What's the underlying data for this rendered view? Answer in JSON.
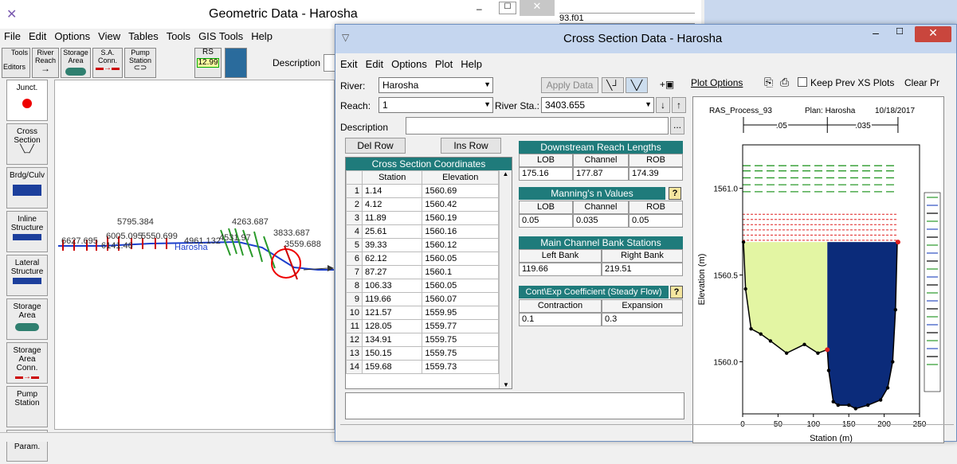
{
  "geo_window": {
    "title": "Geometric Data - Harosha",
    "file_label": "93.f01",
    "menu": [
      "File",
      "Edit",
      "Options",
      "View",
      "Tables",
      "Tools",
      "GIS Tools",
      "Help"
    ],
    "toolbar": {
      "editors_label": "Editors",
      "tools_label": "Tools",
      "river_reach": "River Reach",
      "storage_area": "Storage Area",
      "sa_conn": "S.A. Conn.",
      "pump_station": "Pump Station",
      "rs_label": "RS",
      "rs_value": "12.99",
      "description_label": "Description :"
    },
    "side_tools": [
      "Junct.",
      "Cross Section",
      "Brdg/Culv",
      "Inline Structure",
      "Lateral Structure",
      "Storage Area",
      "Storage Area Conn.",
      "Pump Station",
      "HTab Param."
    ],
    "map_labels": [
      "5795.384",
      "6627.695",
      "6005.095",
      "5550.699",
      "4961.132",
      "4531.97",
      "4263.687",
      "3833.687",
      "3559.688",
      "6141.46",
      "Harosha"
    ]
  },
  "xs_window": {
    "title": "Cross Section Data - Harosha",
    "menu": [
      "Exit",
      "Edit",
      "Options",
      "Plot",
      "Help"
    ],
    "river_label": "River:",
    "river_value": "Harosha",
    "reach_label": "Reach:",
    "reach_value": "1",
    "river_sta_label": "River Sta.:",
    "river_sta_value": "3403.655",
    "apply_data": "Apply Data",
    "description_label": "Description",
    "plot_options": "Plot Options",
    "keep_prev": "Keep Prev XS Plots",
    "clear_prev": "Clear Pr",
    "del_row": "Del Row",
    "ins_row": "Ins Row",
    "coords_title": "Cross Section Coordinates",
    "col_station": "Station",
    "col_elevation": "Elevation",
    "rows": [
      [
        "1",
        "1.14",
        "1560.69"
      ],
      [
        "2",
        "4.12",
        "1560.42"
      ],
      [
        "3",
        "11.89",
        "1560.19"
      ],
      [
        "4",
        "25.61",
        "1560.16"
      ],
      [
        "5",
        "39.33",
        "1560.12"
      ],
      [
        "6",
        "62.12",
        "1560.05"
      ],
      [
        "7",
        "87.27",
        "1560.1"
      ],
      [
        "8",
        "106.33",
        "1560.05"
      ],
      [
        "9",
        "119.66",
        "1560.07"
      ],
      [
        "10",
        "121.57",
        "1559.95"
      ],
      [
        "11",
        "128.05",
        "1559.77"
      ],
      [
        "12",
        "134.91",
        "1559.75"
      ],
      [
        "13",
        "150.15",
        "1559.75"
      ],
      [
        "14",
        "159.68",
        "1559.73"
      ]
    ],
    "ds_title": "Downstream Reach Lengths",
    "lob": "LOB",
    "channel": "Channel",
    "rob": "ROB",
    "ds_values": [
      "175.16",
      "177.87",
      "174.39"
    ],
    "manning_title": "Manning's n Values",
    "manning_values": [
      "0.05",
      "0.035",
      "0.05"
    ],
    "bank_title": "Main Channel Bank Stations",
    "left_bank": "Left Bank",
    "right_bank": "Right Bank",
    "bank_values": [
      "119.66",
      "219.51"
    ],
    "coef_title": "Cont\\Exp Coefficient (Steady Flow)",
    "contraction": "Contraction",
    "expansion": "Expansion",
    "coef_values": [
      "0.1",
      "0.3"
    ]
  },
  "chart_data": {
    "type": "line",
    "header_left": "RAS_Process_93",
    "header_mid": "Plan: Harosha",
    "header_right": "10/18/2017",
    "xlabel": "Station (m)",
    "ylabel": "Elevation (m)",
    "xlim": [
      0,
      250
    ],
    "ylim": [
      1559.7,
      1561.25
    ],
    "xticks": [
      0,
      50,
      100,
      150,
      200,
      250
    ],
    "yticks": [
      1560.0,
      1560.5,
      1561.0
    ],
    "n_labels": [
      ".05",
      ".035"
    ],
    "ground": [
      [
        1.14,
        1560.69
      ],
      [
        4.12,
        1560.42
      ],
      [
        11.89,
        1560.19
      ],
      [
        25.61,
        1560.16
      ],
      [
        39.33,
        1560.12
      ],
      [
        62.12,
        1560.05
      ],
      [
        87.27,
        1560.1
      ],
      [
        106.33,
        1560.05
      ],
      [
        119.66,
        1560.07
      ],
      [
        121.57,
        1559.95
      ],
      [
        128.05,
        1559.77
      ],
      [
        134.91,
        1559.75
      ],
      [
        150.15,
        1559.75
      ],
      [
        159.68,
        1559.73
      ],
      [
        177.0,
        1559.75
      ],
      [
        195.0,
        1559.78
      ],
      [
        205.0,
        1559.85
      ],
      [
        212.0,
        1560.0
      ],
      [
        216.0,
        1560.3
      ],
      [
        218.5,
        1560.69
      ]
    ],
    "water_level": 1560.69,
    "colors": {
      "overbank": "#e3f5a3",
      "channel": "#0b2b7a",
      "ground": "#000000",
      "bank": "#e02020",
      "wse_green": "#2a9a2a",
      "wse_red": "#e02020"
    }
  }
}
